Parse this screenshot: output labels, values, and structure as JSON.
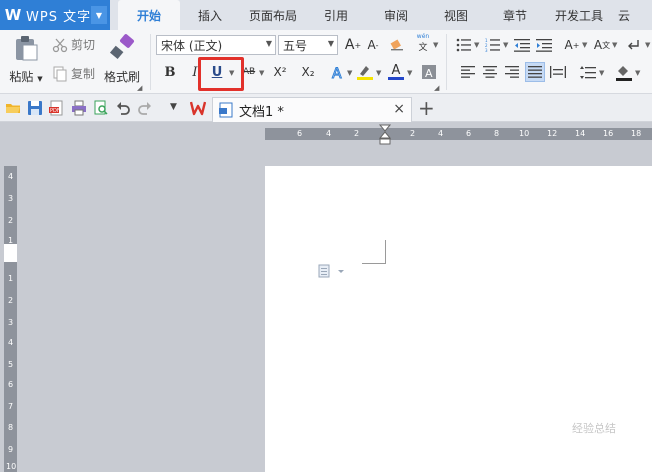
{
  "app": {
    "name": "WPS 文字",
    "logo": "W"
  },
  "menu": {
    "tabs": [
      "开始",
      "插入",
      "页面布局",
      "引用",
      "审阅",
      "视图",
      "章节",
      "开发工具",
      "云"
    ]
  },
  "ribbon": {
    "paste_label": "粘贴",
    "cut_label": "剪切",
    "copy_label": "复制",
    "format_painter_label": "格式刷",
    "font_name": "宋体 (正文)",
    "font_size": "五号",
    "phonetic_label": "文",
    "buttons": {
      "bold": "B",
      "italic": "I",
      "underline": "U",
      "strike": "AB",
      "superscript": "X²",
      "subscript": "X₂",
      "font_color": "A"
    },
    "colors": {
      "accent": "#2f7fd6",
      "highlight_frame": "#e2312b",
      "font_color_bar": "#2346c9",
      "highlight_bar": "#f5e400"
    }
  },
  "document": {
    "tab_title": "文档1 *",
    "close_glyph": "×",
    "new_tab_glyph": "+"
  },
  "ruler": {
    "h_numbers": [
      "6",
      "4",
      "2",
      "2",
      "4",
      "6",
      "8",
      "10",
      "12",
      "14",
      "16",
      "18"
    ],
    "v_numbers": [
      "4",
      "3",
      "2",
      "1",
      "1",
      "2",
      "3",
      "4",
      "5",
      "6",
      "7",
      "8",
      "9",
      "10"
    ]
  },
  "watermark": "经验总结"
}
